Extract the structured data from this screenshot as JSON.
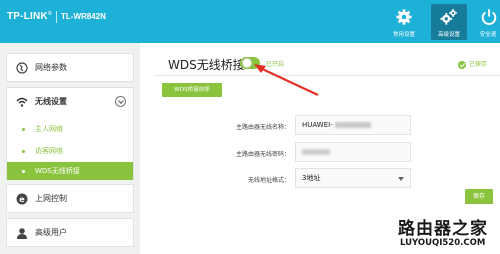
{
  "header": {
    "brand": "TP-LINK",
    "brand_mark": "®",
    "model": "TL-WR842N",
    "nav": [
      {
        "label": "常用设置",
        "icon": "gear-icon",
        "active": false
      },
      {
        "label": "高级设置",
        "icon": "gears-icon",
        "active": true
      },
      {
        "label": "安全退",
        "icon": "power-icon",
        "active": false
      }
    ]
  },
  "sidebar": {
    "items": [
      {
        "label": "网络参数",
        "icon": "globe-icon"
      },
      {
        "label": "无线设置",
        "icon": "wifi-icon",
        "expanded": true,
        "children": [
          {
            "label": "主人网络"
          },
          {
            "label": "访客网络"
          },
          {
            "label": "WDS无线桥接",
            "selected": true
          }
        ]
      },
      {
        "label": "上网控制",
        "icon": "e-circle-icon"
      },
      {
        "label": "高级用户",
        "icon": "user-icon"
      }
    ]
  },
  "main": {
    "title": "WDS无线桥接",
    "toggle_on": true,
    "toggle_label": "已开启",
    "saved_text": "已保存",
    "wizard_button": "WDS桥接向导",
    "fields": [
      {
        "label": "主路由器无线名称：",
        "value": "HUAWEI-"
      },
      {
        "label": "主路由器无线密码：",
        "value": "*****"
      },
      {
        "label": "无线地址格式：",
        "value": "3地址"
      }
    ],
    "save_button": "保存"
  },
  "watermark": {
    "line1": "路由器之家",
    "line2": "LUYOUQI520.COM"
  },
  "colors": {
    "header": "#1eb1d8",
    "accent_green": "#8ac43f",
    "active_nav": "#167c99",
    "annotation": "#e53027"
  }
}
